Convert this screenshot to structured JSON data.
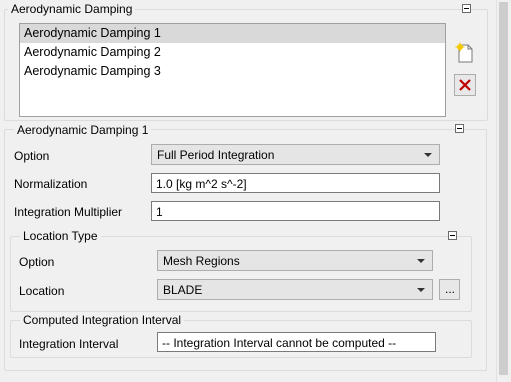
{
  "aero_group": {
    "title": "Aerodynamic Damping",
    "items": [
      "Aerodynamic Damping 1",
      "Aerodynamic Damping 2",
      "Aerodynamic Damping 3"
    ],
    "selected_index": 0
  },
  "details": {
    "title": "Aerodynamic Damping 1",
    "option_label": "Option",
    "option_value": "Full Period Integration",
    "normalization_label": "Normalization",
    "normalization_value": "1.0 [kg m^2 s^-2]",
    "multiplier_label": "Integration Multiplier",
    "multiplier_value": "1"
  },
  "location_type": {
    "title": "Location Type",
    "option_label": "Option",
    "option_value": "Mesh Regions",
    "location_label": "Location",
    "location_value": "BLADE",
    "browse_label": "..."
  },
  "computed": {
    "title": "Computed Integration Interval",
    "interval_label": "Integration Interval",
    "interval_value": "-- Integration Interval cannot be computed --"
  },
  "icons": {
    "new": "new-item-icon",
    "delete": "delete-icon",
    "delete_color": "#c00000"
  }
}
